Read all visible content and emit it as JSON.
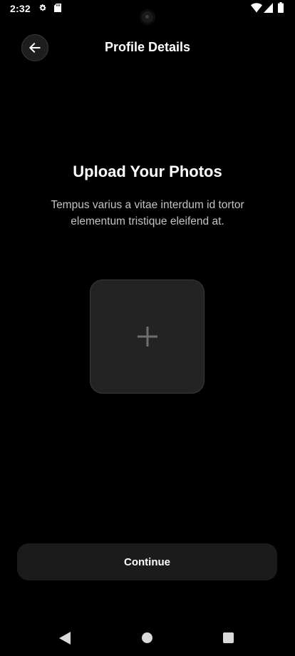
{
  "status_bar": {
    "time": "2:32",
    "icons": [
      "gear-icon",
      "sd-card-icon",
      "wifi-icon",
      "signal-icon",
      "battery-icon"
    ]
  },
  "header": {
    "title": "Profile Details",
    "back_icon": "arrow-left-icon"
  },
  "main": {
    "title": "Upload Your Photos",
    "description": "Tempus varius a vitae interdum id tortor elementum tristique eleifend at.",
    "upload_icon": "plus-icon"
  },
  "footer": {
    "continue_label": "Continue"
  },
  "nav_bar": {
    "icons": [
      "nav-back-icon",
      "nav-home-icon",
      "nav-recents-icon"
    ]
  },
  "colors": {
    "background": "#000000",
    "card": "#232323",
    "button": "#1b1b1b",
    "text_primary": "#ffffff",
    "text_secondary": "#c4c4c4",
    "icon_muted": "#6f6f6f"
  }
}
